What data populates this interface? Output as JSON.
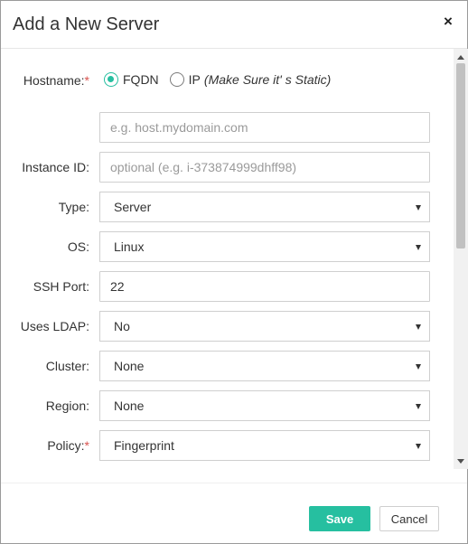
{
  "dialog": {
    "title": "Add a New Server",
    "close_icon": "×"
  },
  "colors": {
    "accent": "#26bfa0",
    "required": "#d9534f",
    "border": "#cfcfcf"
  },
  "form": {
    "hostname": {
      "label": "Hostname:",
      "required_mark": "*",
      "options": [
        {
          "label": "FQDN",
          "checked": true
        },
        {
          "label": "IP",
          "hint": "(Make Sure it' s Static)",
          "checked": false
        }
      ],
      "placeholder": "e.g. host.mydomain.com",
      "value": ""
    },
    "instance_id": {
      "label": "Instance ID:",
      "placeholder": "optional (e.g. i-373874999dhff98)",
      "value": ""
    },
    "type": {
      "label": "Type:",
      "value": "Server"
    },
    "os": {
      "label": "OS:",
      "value": "Linux"
    },
    "ssh_port": {
      "label": "SSH Port:",
      "value": "22"
    },
    "uses_ldap": {
      "label": "Uses LDAP:",
      "value": "No"
    },
    "cluster": {
      "label": "Cluster:",
      "value": "None"
    },
    "region": {
      "label": "Region:",
      "value": "None"
    },
    "policy": {
      "label": "Policy:",
      "required_mark": "*",
      "value": "Fingerprint"
    }
  },
  "footer": {
    "save_label": "Save",
    "cancel_label": "Cancel"
  }
}
